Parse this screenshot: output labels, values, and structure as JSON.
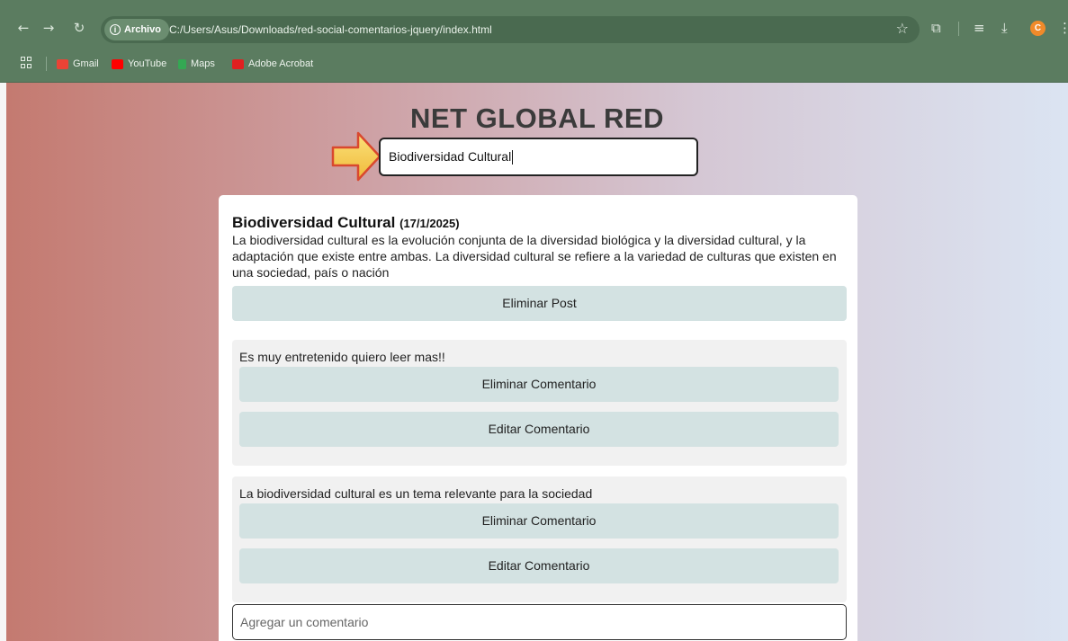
{
  "browser": {
    "site_chip_label": "Archivo",
    "url": "C:/Users/Asus/Downloads/red-social-comentarios-jquery/index.html",
    "profile_initial": "C",
    "bookmarks": [
      {
        "label": "Gmail",
        "color": "#ea4335"
      },
      {
        "label": "YouTube",
        "color": "#ff0000"
      },
      {
        "label": "Maps",
        "color": "#34a853"
      },
      {
        "label": "Adobe Acrobat",
        "color": "#e02020"
      }
    ]
  },
  "page": {
    "site_title": "NET GLOBAL RED",
    "search_value": "Biodiversidad Cultural",
    "post": {
      "title": "Biodiversidad Cultural",
      "date": "(17/1/2025)",
      "body": "La biodiversidad cultural es la evolución conjunta de la diversidad biológica y la diversidad cultural, y la adaptación que existe entre ambas. La diversidad cultural se refiere a la variedad de culturas que existen en una sociedad, país o nación",
      "delete_label": "Eliminar Post"
    },
    "comments": [
      {
        "text": "Es muy entretenido quiero leer mas!!",
        "delete_label": "Eliminar Comentario",
        "edit_label": "Editar Comentario"
      },
      {
        "text": "La biodiversidad cultural es un tema relevante para la sociedad",
        "delete_label": "Eliminar Comentario",
        "edit_label": "Editar Comentario"
      }
    ],
    "new_comment_placeholder": "Agregar un comentario"
  },
  "colors": {
    "chrome": "#5b7c60",
    "button": "#d3e2e2",
    "arrow": "#f7d34a"
  }
}
